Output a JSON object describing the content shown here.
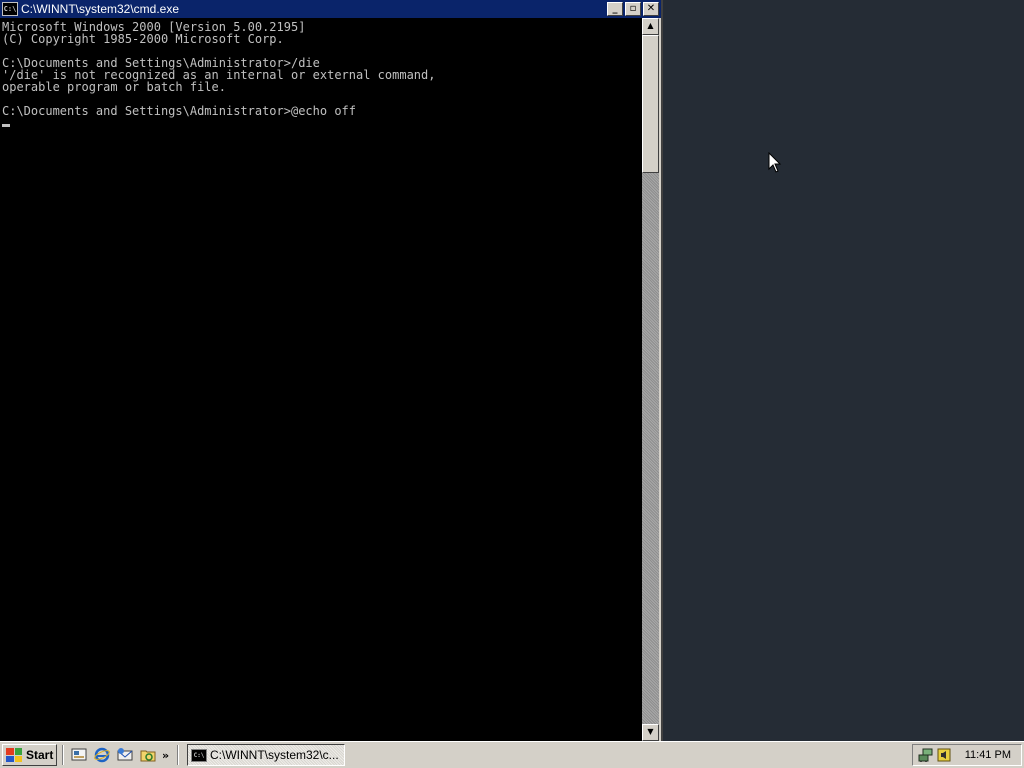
{
  "window": {
    "title": "C:\\WINNT\\system32\\cmd.exe",
    "icon_text": "C:\\",
    "buttons": {
      "minimize": "_",
      "restore": "▫",
      "close": "✕"
    }
  },
  "console": {
    "lines": [
      "Microsoft Windows 2000 [Version 5.00.2195]",
      "(C) Copyright 1985-2000 Microsoft Corp.",
      "",
      "C:\\Documents and Settings\\Administrator>/die",
      "'/die' is not recognized as an internal or external command,",
      "operable program or batch file.",
      "",
      "C:\\Documents and Settings\\Administrator>@echo off"
    ]
  },
  "scrollbar": {
    "up": "▲",
    "down": "▼"
  },
  "taskbar": {
    "start_label": "Start",
    "quicklaunch": [
      "show-desktop-icon",
      "ie-icon",
      "outlook-icon",
      "explorer-icon"
    ],
    "quicklaunch_more": "»",
    "task_label": "C:\\WINNT\\system32\\c...",
    "task_icon_text": "C:\\",
    "tray_icons": [
      "network-icon",
      "volume-icon"
    ],
    "clock": "11:41 PM"
  },
  "colors": {
    "desktop": "#252c35",
    "titlebar": "#0a246a",
    "console_bg": "#000000",
    "console_fg": "#c0c0c0",
    "chrome": "#d4d0c8"
  }
}
